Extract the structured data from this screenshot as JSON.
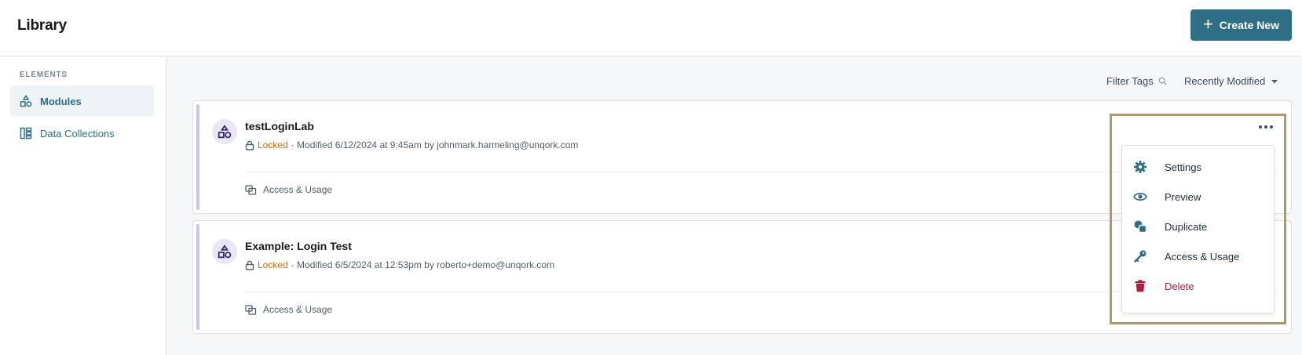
{
  "header": {
    "title": "Library",
    "create_label": "Create New"
  },
  "sidebar": {
    "section_label": "ELEMENTS",
    "items": [
      {
        "label": "Modules",
        "icon": "modules-icon",
        "active": true
      },
      {
        "label": "Data Collections",
        "icon": "data-collections-icon",
        "active": false
      }
    ]
  },
  "toolbar": {
    "filter_label": "Filter Tags",
    "sort_label": "Recently Modified"
  },
  "cards": [
    {
      "name": "testLoginLab",
      "status": "Locked",
      "modified": "· Modified 6/12/2024 at 9:45am by johnmark.harmeling@unqork.com",
      "access_label": "Access & Usage"
    },
    {
      "name": "Example: Login Test",
      "status": "Locked",
      "modified": "· Modified 6/5/2024 at 12:53pm by roberto+demo@unqork.com",
      "access_label": "Access & Usage"
    }
  ],
  "menu": {
    "items": [
      {
        "label": "Settings",
        "icon": "gear-icon"
      },
      {
        "label": "Preview",
        "icon": "eye-icon"
      },
      {
        "label": "Duplicate",
        "icon": "duplicate-icon"
      },
      {
        "label": "Access & Usage",
        "icon": "key-icon"
      },
      {
        "label": "Delete",
        "icon": "trash-icon",
        "color": "#b3183d"
      }
    ]
  },
  "colors": {
    "accent": "#2e6f86",
    "locked": "#c96d14",
    "danger": "#b3183d",
    "highlight": "#b09a62"
  }
}
